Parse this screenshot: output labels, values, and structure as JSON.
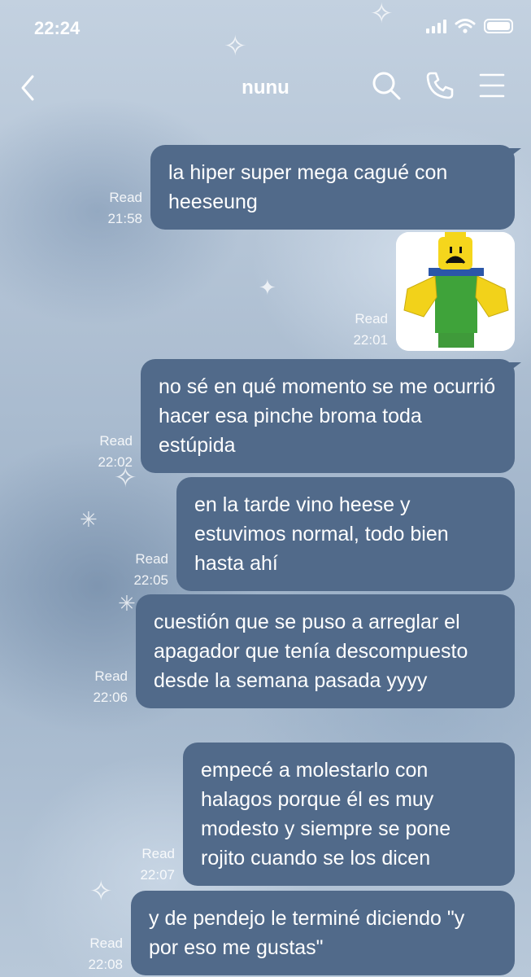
{
  "status_bar": {
    "time": "22:24"
  },
  "header": {
    "title": "nunu"
  },
  "messages": [
    {
      "type": "text",
      "text": "la hiper super mega cagué con heeseung",
      "read_label": "Read",
      "time": "21:58"
    },
    {
      "type": "image",
      "image_label": "roblox-crying-character",
      "read_label": "Read",
      "time": "22:01"
    },
    {
      "type": "text",
      "text": "no sé en qué momento se me ocurrió hacer esa pinche broma toda estúpida",
      "read_label": "Read",
      "time": "22:02"
    },
    {
      "type": "text",
      "text": "en la tarde vino heese y estuvimos normal, todo bien hasta ahí",
      "read_label": "Read",
      "time": "22:05"
    },
    {
      "type": "text",
      "text": "cuestión que se puso a arreglar el apagador que tenía descompuesto desde la semana pasada yyyy",
      "read_label": "Read",
      "time": "22:06"
    },
    {
      "type": "text",
      "text": "empecé a molestarlo con halagos porque él es muy modesto y siempre se pone rojito cuando se los dicen",
      "read_label": "Read",
      "time": "22:07"
    },
    {
      "type": "text",
      "text": "y de pendejo le terminé diciendo \"y por eso me gustas\"",
      "read_label": "Read",
      "time": "22:08"
    }
  ],
  "colors": {
    "bubble": "#516a8a",
    "background": "#b7c7d8",
    "text": "#ffffff"
  },
  "icons": [
    "back-icon",
    "search-icon",
    "phone-icon",
    "menu-icon",
    "wifi-icon",
    "signal-icon",
    "battery-icon"
  ]
}
